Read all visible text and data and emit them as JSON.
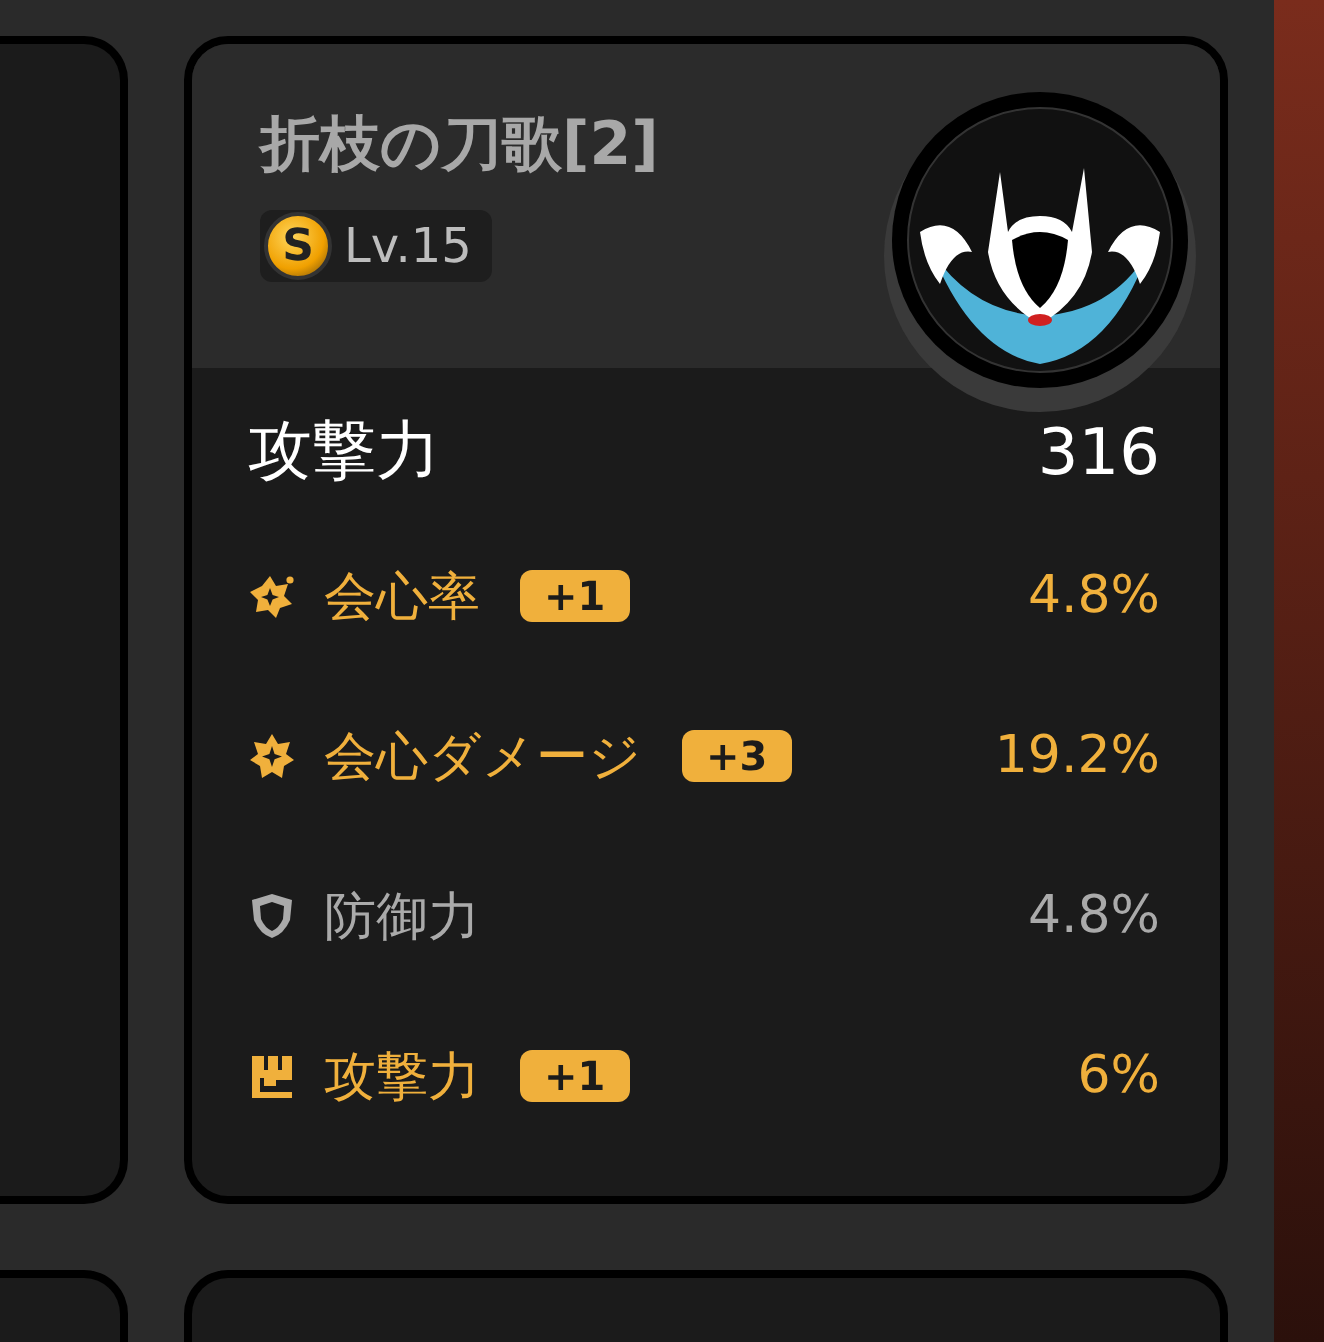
{
  "disc": {
    "title": "折枝の刀歌[2]",
    "rank": "S",
    "level": "Lv.15"
  },
  "main_stat": {
    "label": "攻撃力",
    "value": "316"
  },
  "sub_stats": [
    {
      "kind": "crit_rate",
      "label": "会心率",
      "bonus": "+1",
      "value": "4.8%",
      "highlighted": true
    },
    {
      "kind": "crit_damage",
      "label": "会心ダメージ",
      "bonus": "+3",
      "value": "19.2%",
      "highlighted": true
    },
    {
      "kind": "defense",
      "label": "防御力",
      "value": "4.8%",
      "highlighted": false
    },
    {
      "kind": "attack",
      "label": "攻撃力",
      "bonus": "+1",
      "value": "6%",
      "highlighted": true
    }
  ]
}
